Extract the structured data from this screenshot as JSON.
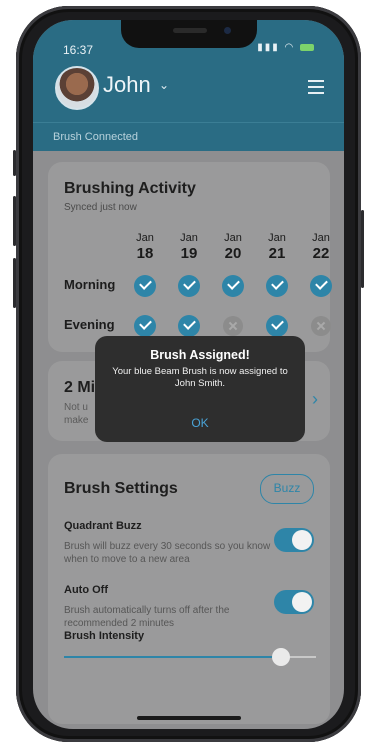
{
  "status": {
    "time": "16:37"
  },
  "header": {
    "user_name": "John"
  },
  "connection": {
    "text": "Brush Connected"
  },
  "activity": {
    "title": "Brushing Activity",
    "subtitle": "Synced just now",
    "days": [
      {
        "month": "Jan",
        "day": "18"
      },
      {
        "month": "Jan",
        "day": "19"
      },
      {
        "month": "Jan",
        "day": "20"
      },
      {
        "month": "Jan",
        "day": "21"
      },
      {
        "month": "Jan",
        "day": "22"
      }
    ],
    "rows": [
      {
        "label": "Morning",
        "status": [
          "done",
          "done",
          "done",
          "done",
          "done"
        ]
      },
      {
        "label": "Evening",
        "status": [
          "done",
          "done",
          "missed",
          "done",
          "missed"
        ]
      }
    ]
  },
  "two_min_card": {
    "title": "2 Mi",
    "line1": "Not u",
    "line2": "make"
  },
  "dialog": {
    "title": "Brush Assigned!",
    "message": "Your blue Beam  Brush is now assigned to John Smith.",
    "ok_label": "OK"
  },
  "settings": {
    "title": "Brush Settings",
    "buzz_label": "Buzz",
    "quadrant": {
      "label": "Quadrant Buzz",
      "description": "Brush will buzz every 30 seconds so you know when to move to a new area",
      "enabled": true
    },
    "auto_off": {
      "label": "Auto Off",
      "description": "Brush automatically turns off after the recommended 2 minutes",
      "enabled": true
    },
    "intensity": {
      "label": "Brush Intensity",
      "level": 0.83
    }
  },
  "colors": {
    "accent": "#2e85a8",
    "header": "#2a6c84",
    "dialog": "#2e2e2e"
  }
}
